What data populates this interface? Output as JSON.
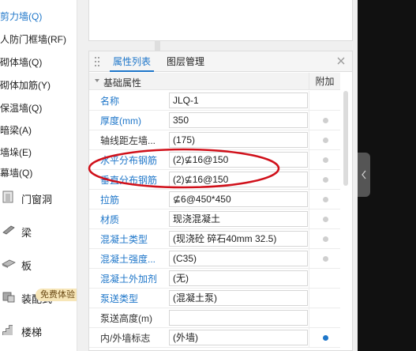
{
  "tree": {
    "items": [
      {
        "label": "剪力墙(Q)",
        "active": true
      },
      {
        "label": "人防门框墙(RF)",
        "active": false
      },
      {
        "label": "砌体墙(Q)",
        "active": false
      },
      {
        "label": "砌体加筋(Y)",
        "active": false
      },
      {
        "label": "保温墙(Q)",
        "active": false
      },
      {
        "label": "暗梁(A)",
        "active": false
      },
      {
        "label": "墙垛(E)",
        "active": false
      },
      {
        "label": "幕墙(Q)",
        "active": false
      }
    ],
    "categories": [
      {
        "label": "门窗洞",
        "icon": "door-window-icon"
      },
      {
        "label": "梁",
        "icon": "beam-icon"
      },
      {
        "label": "板",
        "icon": "slab-icon"
      },
      {
        "label": "装配式",
        "icon": "prefab-icon"
      },
      {
        "label": "楼梯",
        "icon": "stairs-icon"
      }
    ],
    "promo_badge": "免费体验"
  },
  "props_panel": {
    "tabs": [
      "属性列表",
      "图层管理"
    ],
    "active_tab": "属性列表",
    "section_title": "基础属性",
    "attach_header": "附加",
    "rows": [
      {
        "name": "名称",
        "value": "JLQ-1",
        "name_color": "blue",
        "attach": "none"
      },
      {
        "name": "厚度(mm)",
        "value": "350",
        "name_color": "blue",
        "attach": "off"
      },
      {
        "name": "轴线距左墙...",
        "value": "(175)",
        "name_color": "black",
        "attach": "off"
      },
      {
        "name": "水平分布钢筋",
        "value": "(2)⊈16@150",
        "name_color": "blue",
        "attach": "off"
      },
      {
        "name": "垂直分布钢筋",
        "value": "(2)⊈16@150",
        "name_color": "blue",
        "attach": "off"
      },
      {
        "name": "拉筋",
        "value": "⊈6@450*450",
        "name_color": "blue",
        "attach": "off"
      },
      {
        "name": "材质",
        "value": "现浇混凝土",
        "name_color": "blue",
        "attach": "off"
      },
      {
        "name": "混凝土类型",
        "value": "(现浇砼 碎石40mm 32.5)",
        "name_color": "blue",
        "attach": "off"
      },
      {
        "name": "混凝土强度...",
        "value": "(C35)",
        "name_color": "blue",
        "attach": "off"
      },
      {
        "name": "混凝土外加剂",
        "value": "(无)",
        "name_color": "blue",
        "attach": "none"
      },
      {
        "name": "泵送类型",
        "value": "(混凝土泵)",
        "name_color": "blue",
        "attach": "none"
      },
      {
        "name": "泵送高度(m)",
        "value": "",
        "name_color": "black",
        "attach": "none"
      },
      {
        "name": "内/外墙标志",
        "value": "(外墙)",
        "name_color": "black",
        "attach": "on"
      }
    ]
  },
  "colors": {
    "accent": "#1e76c9",
    "annotation": "#d0101a",
    "dark_side": "#111111",
    "promo": "#f7e6b8"
  }
}
